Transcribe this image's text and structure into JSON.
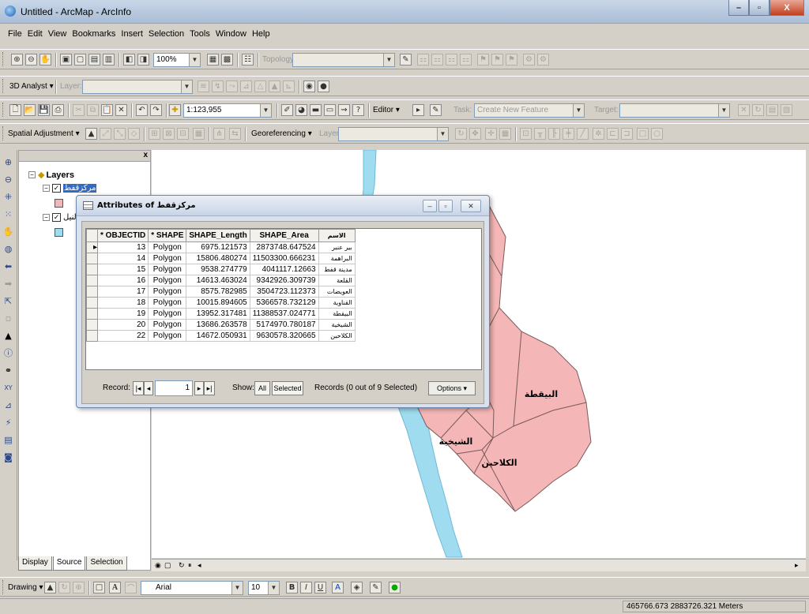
{
  "window": {
    "title": "Untitled - ArcMap - ArcInfo"
  },
  "menu": [
    "File",
    "Edit",
    "View",
    "Bookmarks",
    "Insert",
    "Selection",
    "Tools",
    "Window",
    "Help"
  ],
  "toolbar1": {
    "zoom": "100%",
    "topology_label": "Topology:"
  },
  "toolbar2": {
    "analyst_label": "3D Analyst ▾",
    "layer_label": "Layer:"
  },
  "toolbar3": {
    "scale": "1:123,955",
    "editor_label": "Editor ▾",
    "task_label": "Task:",
    "task_value": "Create New Feature",
    "target_label": "Target:"
  },
  "toolbar4": {
    "spatial_label": "Spatial Adjustment ▾",
    "georef_label": "Georeferencing ▾",
    "layer_label": "Layer:"
  },
  "toc": {
    "root": "Layers",
    "layer1": "مركزقفط",
    "layer2": "النيل",
    "tabs": [
      "Display",
      "Source",
      "Selection"
    ]
  },
  "attributes": {
    "title": "Attributes of مركزقفط",
    "columns": [
      "* OBJECTID",
      "* SHAPE",
      "SHAPE_Length",
      "SHAPE_Area",
      "الاسم"
    ],
    "rows": [
      [
        "13",
        "Polygon",
        "6975.121573",
        "2873748.647524",
        "بير عنبر"
      ],
      [
        "14",
        "Polygon",
        "15806.480274",
        "11503300.666231",
        "البراهمة"
      ],
      [
        "15",
        "Polygon",
        "9538.274779",
        "4041117.12663",
        "مدينة قفط"
      ],
      [
        "16",
        "Polygon",
        "14613.463024",
        "9342926.309739",
        "القلعة"
      ],
      [
        "17",
        "Polygon",
        "8575.782985",
        "3504723.112373",
        "العويضات"
      ],
      [
        "18",
        "Polygon",
        "10015.894605",
        "5366578.732129",
        "القناوية"
      ],
      [
        "19",
        "Polygon",
        "13952.317481",
        "11388537.024771",
        "البيقطة"
      ],
      [
        "20",
        "Polygon",
        "13686.263578",
        "5174970.780187",
        "الشيخية"
      ],
      [
        "22",
        "Polygon",
        "14672.050931",
        "9630578.320665",
        "الكلاحين"
      ]
    ],
    "record_label": "Record:",
    "record_value": "1",
    "show_label": "Show:",
    "all_label": "All",
    "selected_label": "Selected",
    "records_info": "Records (0 out of 9 Selected)",
    "options_label": "Options ▾"
  },
  "map": {
    "labels": [
      "البيقطة",
      "الشيخية",
      "الكلاحين"
    ],
    "polygon_color": "#f4b6b6",
    "river_color": "#9fdcf0"
  },
  "drawing": {
    "label": "Drawing ▾",
    "font": "Arial",
    "size": "10"
  },
  "status": {
    "coords": "465766.673  2883726.321 Meters"
  }
}
